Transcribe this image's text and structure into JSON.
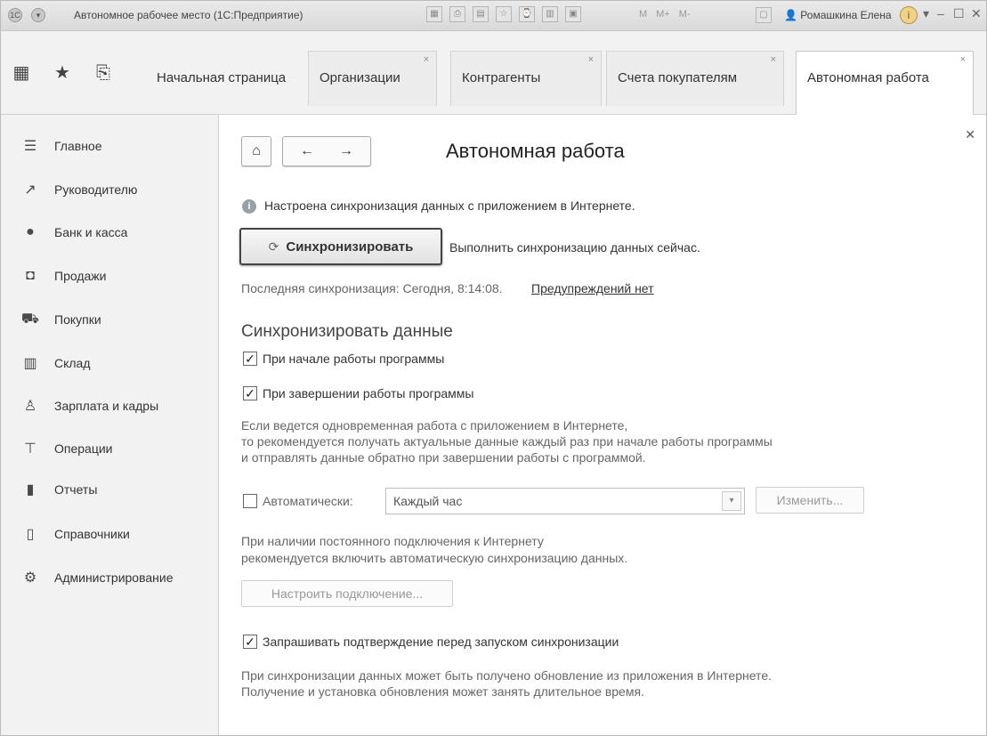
{
  "window": {
    "title": "Автономное рабочее место (1С:Предприятие)",
    "user": "Ромашкина Елена",
    "m_tools": [
      "M",
      "M+",
      "M-"
    ]
  },
  "tabs": [
    {
      "label": "Начальная страница",
      "closable": false
    },
    {
      "label": "Организации",
      "closable": true
    },
    {
      "label": "Контрагенты",
      "closable": true
    },
    {
      "label": "Счета покупателям",
      "closable": true
    },
    {
      "label": "Автономная работа",
      "closable": true,
      "active": true
    }
  ],
  "sidebar": {
    "items": [
      {
        "label": "Главное",
        "icon": "menu-icon"
      },
      {
        "label": "Руководителю",
        "icon": "chart-line-icon"
      },
      {
        "label": "Банк и касса",
        "icon": "coin-icon"
      },
      {
        "label": "Продажи",
        "icon": "shopping-bag-icon"
      },
      {
        "label": "Покупки",
        "icon": "cart-icon"
      },
      {
        "label": "Склад",
        "icon": "warehouse-icon"
      },
      {
        "label": "Зарплата и кадры",
        "icon": "person-icon"
      },
      {
        "label": "Операции",
        "icon": "operations-icon"
      },
      {
        "label": "Отчеты",
        "icon": "bar-chart-icon"
      },
      {
        "label": "Справочники",
        "icon": "book-icon"
      },
      {
        "label": "Администрирование",
        "icon": "gear-icon"
      }
    ]
  },
  "main": {
    "title": "Автономная работа",
    "info": "Настроена синхронизация данных с приложением в Интернете.",
    "sync_button": "Синхронизировать",
    "sync_hint": "Выполнить синхронизацию данных сейчас.",
    "last_sync_label": "Последняя синхронизация: Сегодня, 8:14:08.",
    "warnings_link": "Предупреждений нет",
    "section_title": "Синхронизировать данные",
    "cb_start": "При начале работы программы",
    "cb_end": "При завершении работы программы",
    "note1": [
      "Если ведется одновременная работа с приложением в Интернете,",
      "то рекомендуется получать актуальные данные каждый раз при начале работы программы",
      "и отправлять данные обратно при завершении работы с программой."
    ],
    "auto_label": "Автоматически:",
    "auto_value": "Каждый час",
    "change_button": "Изменить...",
    "note2": [
      "При наличии постоянного подключения к Интернету",
      "рекомендуется включить автоматическую синхронизацию данных."
    ],
    "setup_button": "Настроить подключение...",
    "cb_confirm": "Запрашивать подтверждение перед запуском синхронизации",
    "note3": [
      "При синхронизации данных может быть получено обновление из приложения в Интернете.",
      "Получение и установка обновления может занять длительное время."
    ]
  }
}
